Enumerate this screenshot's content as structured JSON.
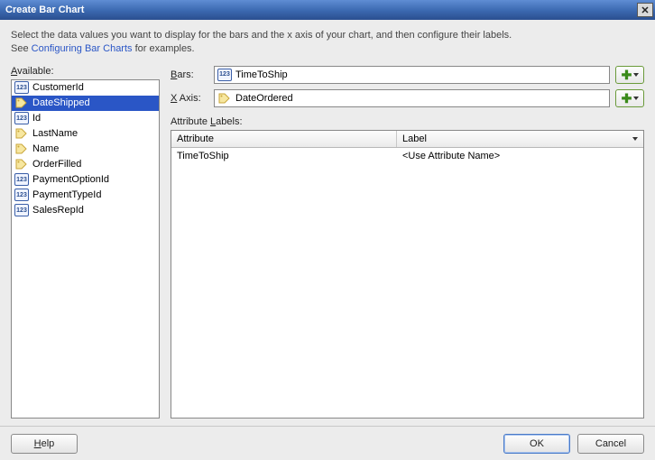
{
  "window": {
    "title": "Create Bar Chart"
  },
  "instructions": {
    "line1": "Select the data values you want to display for the bars and the x axis of your chart, and then configure their labels.",
    "line2_prefix": "See ",
    "link_text": "Configuring Bar Charts",
    "line2_suffix": " for examples."
  },
  "available": {
    "label": "Available:",
    "items": [
      {
        "name": "CustomerId",
        "icon": "123",
        "selected": false
      },
      {
        "name": "DateShipped",
        "icon": "tag",
        "selected": true
      },
      {
        "name": "Id",
        "icon": "123",
        "selected": false
      },
      {
        "name": "LastName",
        "icon": "tag",
        "selected": false
      },
      {
        "name": "Name",
        "icon": "tag",
        "selected": false
      },
      {
        "name": "OrderFilled",
        "icon": "tag",
        "selected": false
      },
      {
        "name": "PaymentOptionId",
        "icon": "123",
        "selected": false
      },
      {
        "name": "PaymentTypeId",
        "icon": "123",
        "selected": false
      },
      {
        "name": "SalesRepId",
        "icon": "123",
        "selected": false
      }
    ]
  },
  "fields": {
    "bars": {
      "label": "Bars:",
      "value": "TimeToShip",
      "icon": "123"
    },
    "xaxis": {
      "label": "X Axis:",
      "value": "DateOrdered",
      "icon": "tag"
    }
  },
  "attribute_labels": {
    "heading": "Attribute Labels:",
    "columns": {
      "attribute": "Attribute",
      "label": "Label"
    },
    "rows": [
      {
        "attribute": "TimeToShip",
        "label": "<Use Attribute Name>"
      }
    ]
  },
  "buttons": {
    "help": "Help",
    "ok": "OK",
    "cancel": "Cancel"
  }
}
